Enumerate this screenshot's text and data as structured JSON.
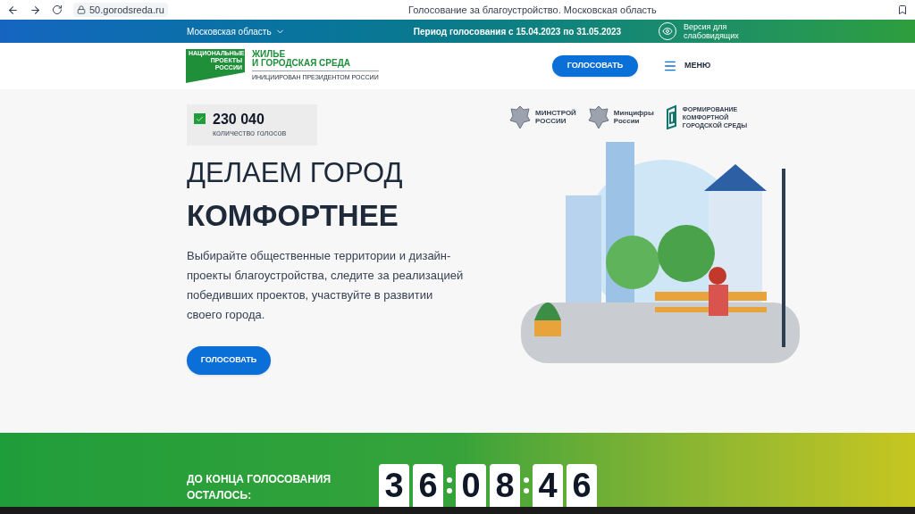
{
  "browser": {
    "url": "50.gorodsreda.ru",
    "title": "Голосование за благоустройство. Московская область"
  },
  "topbar": {
    "region": "Московская область",
    "period": "Период голосования с 15.04.2023 по 31.05.2023",
    "accessibility": "Версия для слабовидящих"
  },
  "header": {
    "logo_badge": "НАЦИОНАЛЬНЫЕ ПРОЕКТЫ РОССИИ",
    "logo_title": [
      "ЖИЛЬЕ",
      "И ГОРОДСКАЯ СРЕДА"
    ],
    "logo_subtitle": "ИНИЦИИРОВАН ПРЕЗИДЕНТОМ РОССИИ",
    "vote_button": "ГОЛОСОВАТЬ",
    "menu": "МЕНЮ"
  },
  "votes": {
    "count": "230 040",
    "label": "количество голосов"
  },
  "partners": [
    {
      "kind": "emblem",
      "lines": [
        "МИНСТРОЙ",
        "РОССИИ"
      ]
    },
    {
      "kind": "emblem",
      "lines": [
        "Минцифры",
        "России"
      ]
    },
    {
      "kind": "mark",
      "lines": [
        "ФОРМИРОВАНИЕ",
        "КОМФОРТНОЙ",
        "ГОРОДСКОЙ СРЕДЫ"
      ]
    }
  ],
  "hero": {
    "title_light": "ДЕЛАЕМ ГОРОД",
    "title_bold": "КОМФОРТНЕЕ",
    "text": "Выбирайте общественные территории и дизайн-проекты благоустройства, следите за реализацией победивших проектов, участвуйте в развитии своего города.",
    "button": "ГОЛОСОВАТЬ"
  },
  "countdown": {
    "label": [
      "ДО КОНЦА ГОЛОСОВАНИЯ",
      "ОСТАЛОСЬ:"
    ],
    "groups": [
      [
        "3",
        "6"
      ],
      [
        "0",
        "8"
      ],
      [
        "4",
        "6"
      ]
    ]
  }
}
